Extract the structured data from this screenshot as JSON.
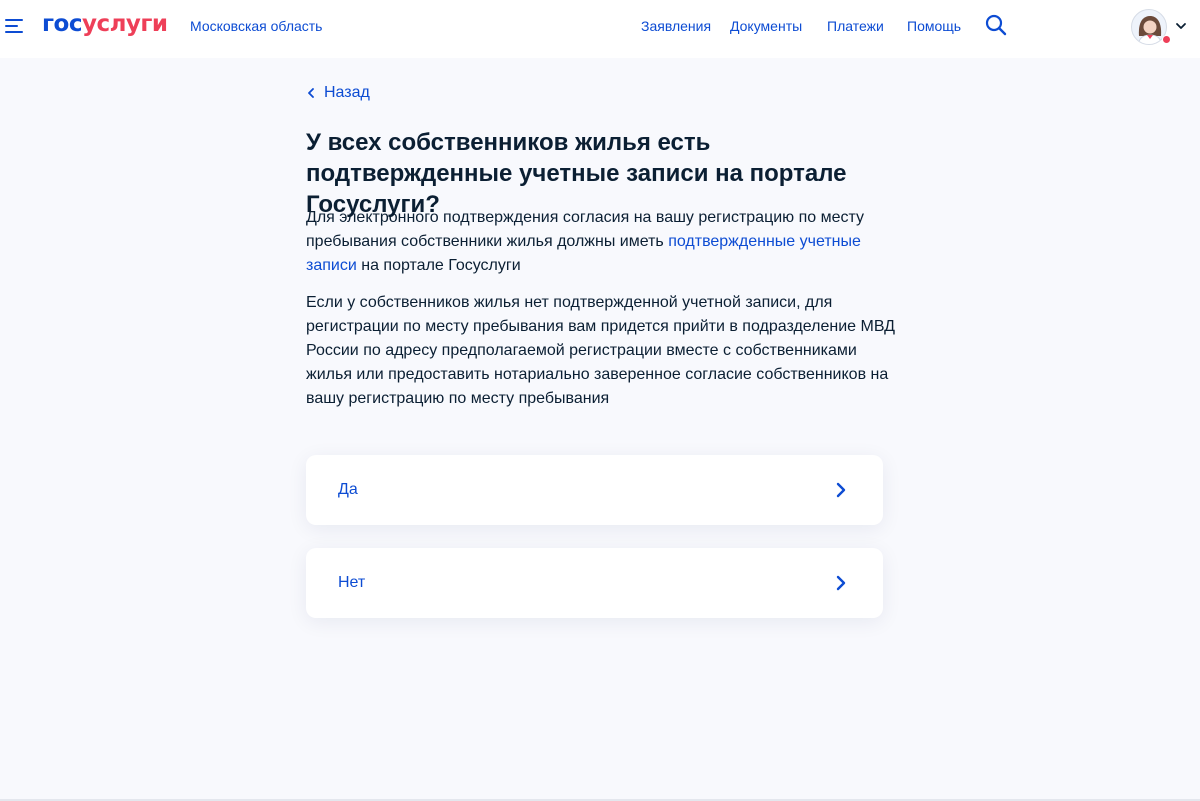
{
  "header": {
    "logo_part1": "гос",
    "logo_part2": "услуги",
    "region": "Московская область",
    "nav": [
      "Заявления",
      "Документы",
      "Платежи",
      "Помощь"
    ],
    "icons": [
      "menu-icon",
      "search-icon",
      "avatar",
      "chevron-down-icon"
    ]
  },
  "main": {
    "back_label": "Назад",
    "title": "У всех собственников жилья есть подтвержденные учетные записи на портале Госуслуги?",
    "para1_before": "Для электронного подтверждения согласия на вашу регистрацию по месту пребывания собственники жилья должны иметь ",
    "para1_link": "подтвержденные учетные записи",
    "para1_after": " на портале Госуслуги",
    "para2": "Если у собственников жилья нет подтвержденной учетной записи, для регистрации по месту пребывания вам придется прийти в подразделение МВД России по адресу предполагаемой регистрации вместе с собственниками жилья или предоставить нотариально заверенное согласие собственников на вашу регистрацию по месту пребывания",
    "options": [
      "Да",
      "Нет"
    ]
  },
  "colors": {
    "accent": "#0d4cd3",
    "brand_red": "#ee3f58",
    "text": "#0b1f33",
    "page_bg": "#f8f9fd"
  }
}
